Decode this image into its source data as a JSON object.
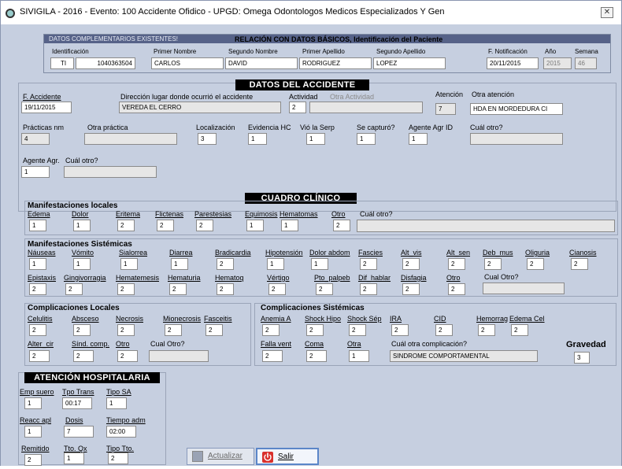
{
  "window": {
    "title": "SIVIGILA - 2016 - Evento: 100  Accidente Ofidico - UPGD: Omega Odontologos Medicos Especializados Y Gen",
    "close_glyph": "✕"
  },
  "basic": {
    "existing_label": "DATOS COMPLEMENTARIOS EXISTENTES!",
    "relation_label": "RELACIÓN CON DATOS BÁSICOS, Identificación del Paciente",
    "id_label": "Identificación",
    "id_type": "TI",
    "id_number": "1040363504",
    "first_name_label": "Primer Nombre",
    "first_name": "CARLOS",
    "second_name_label": "Segundo Nombre",
    "second_name": "DAVID",
    "first_surname_label": "Primer Apellido",
    "first_surname": "RODRIGUEZ",
    "second_surname_label": "Segundo Apellido",
    "second_surname": "LOPEZ",
    "notif_date_label": "F. Notificación",
    "notif_date": "20/11/2015",
    "year_label": "Año",
    "year": "2015",
    "week_label": "Semana",
    "week": "46"
  },
  "accident": {
    "header": "DATOS DEL ACCIDENTE",
    "date_label": "F. Accidente",
    "date": "19/11/2015",
    "place_label": "Dirección lugar donde ocurrió el accidente",
    "place": "VEREDA EL CERRO",
    "activity_label": "Actividad",
    "activity": "2",
    "other_activity_label": "Otra Actividad",
    "other_activity": "",
    "attention_label": "Atención",
    "attention": "7",
    "other_attention_label": "Otra atención",
    "other_attention": "HDA EN MORDEDURA CI",
    "practices_label": "Prácticas nm",
    "practices": "4",
    "other_practice_label": "Otra práctica",
    "other_practice": "",
    "location_label": "Localización",
    "location": "3",
    "evidence_label": "Evidencia HC",
    "evidence": "1",
    "saw_snake_label": "Vió la Serp",
    "saw_snake": "1",
    "captured_label": "Se capturó?",
    "captured": "1",
    "agent_id_label": "Agente Agr ID",
    "agent_id": "1",
    "which_other_label": "Cuál otro?",
    "which_other": "",
    "agent_label": "Agente Agr.",
    "agent": "1",
    "agent_other_label": "Cuál otro?",
    "agent_other": ""
  },
  "clinical": {
    "header": "CUADRO CLÍNICO",
    "local_title": "Manifestaciones locales",
    "local": [
      {
        "label": "Edema",
        "value": "1"
      },
      {
        "label": "Dolor",
        "value": "1"
      },
      {
        "label": "Eritema",
        "value": "2"
      },
      {
        "label": "Flictenas",
        "value": "2"
      },
      {
        "label": "Parestesias",
        "value": "2"
      },
      {
        "label": "Equimosis",
        "value": "1"
      },
      {
        "label": "Hematomas",
        "value": "1"
      },
      {
        "label": "Otro",
        "value": "2"
      }
    ],
    "local_other_label": "Cuál otro?",
    "local_other": "",
    "systemic_title": "Manifestaciones Sistémicas",
    "systemic_row1": [
      {
        "label": "Náuseas",
        "value": "1"
      },
      {
        "label": "Vómito",
        "value": "1"
      },
      {
        "label": "Sialorrea",
        "value": "1"
      },
      {
        "label": "Diarrea",
        "value": "1"
      },
      {
        "label": "Bradicardia",
        "value": "2"
      },
      {
        "label": "Hipotensión",
        "value": "1"
      },
      {
        "label": "Dolor abdom",
        "value": "1"
      },
      {
        "label": "Fascies",
        "value": "2"
      },
      {
        "label": "Alt_vis",
        "value": "2"
      },
      {
        "label": "Alt_sen",
        "value": "2"
      },
      {
        "label": "Deb_mus",
        "value": "2"
      },
      {
        "label": "Oliguria",
        "value": "2"
      },
      {
        "label": "Cianosis",
        "value": "2"
      }
    ],
    "systemic_row2": [
      {
        "label": "Epistaxis",
        "value": "2"
      },
      {
        "label": "Gingivorragia",
        "value": "2"
      },
      {
        "label": "Hematemesis",
        "value": "2"
      },
      {
        "label": "Hematuria",
        "value": "2"
      },
      {
        "label": "Hematoq",
        "value": "2"
      },
      {
        "label": "Vértigo",
        "value": "2"
      },
      {
        "label": "Pto_palpeb",
        "value": "2"
      },
      {
        "label": "Dif_hablar",
        "value": "2"
      },
      {
        "label": "Disfagia",
        "value": "2"
      },
      {
        "label": "Otro",
        "value": "2"
      }
    ],
    "systemic_other_label": "Cual Otro?",
    "systemic_other": ""
  },
  "complications": {
    "local_title": "Complicaciones Locales",
    "local_row1": [
      {
        "label": "Celulitis",
        "value": "2"
      },
      {
        "label": "Absceso",
        "value": "2"
      },
      {
        "label": "Necrosis",
        "value": "2"
      },
      {
        "label": "Mionecrosis",
        "value": "2"
      },
      {
        "label": "Fasceitis",
        "value": "2"
      }
    ],
    "local_row2": [
      {
        "label": "Alter_cir",
        "value": "2"
      },
      {
        "label": "Sínd. comp.",
        "value": "2"
      },
      {
        "label": "Otro",
        "value": "2"
      }
    ],
    "local_other_label": "Cual Otro?",
    "local_other": "",
    "systemic_title": "Complicaciones Sistémicas",
    "systemic_row1": [
      {
        "label": "Anemia A",
        "value": "2"
      },
      {
        "label": "Shock Hipo",
        "value": "2"
      },
      {
        "label": "Shock Sép",
        "value": "2"
      },
      {
        "label": "IRA",
        "value": "2"
      },
      {
        "label": "CID",
        "value": "2"
      },
      {
        "label": "Hemorrag",
        "value": "2"
      },
      {
        "label": "Edema Cel",
        "value": "2"
      }
    ],
    "systemic_row2": [
      {
        "label": "Falla vent",
        "value": "2"
      },
      {
        "label": "Coma",
        "value": "2"
      },
      {
        "label": "Otra",
        "value": "1"
      }
    ],
    "systemic_other_label": "Cuál otra complicación?",
    "systemic_other": "SINDROME COMPORTAMENTAL",
    "severity_label": "Gravedad",
    "severity": "3"
  },
  "hospital": {
    "header": "ATENCIÓN HOSPITALARIA",
    "emp_suero_label": "Emp suero",
    "emp_suero": "1",
    "tpo_trans_label": "Tpo Trans",
    "tpo_trans": "00:17",
    "tipo_sa_label": "Tipo SA",
    "tipo_sa": "1",
    "reacc_label": "Reacc apl",
    "reacc": "1",
    "dosis_label": "Dosis",
    "dosis": "7",
    "tiempo_adm_label": "Tiempo adm",
    "tiempo_adm": "02:00",
    "remitido_label": "Remitido",
    "remitido": "2",
    "tto_qx_label": "Tto. Qx",
    "tto_qx": "1",
    "tipo_tto_label": "Tipo Tto.",
    "tipo_tto": "2"
  },
  "buttons": {
    "update": "Actualizar",
    "exit": "Salir"
  },
  "colors": {
    "background": "#c6cfe0",
    "header_band": "#000000",
    "exit_icon": "#d9302c"
  }
}
